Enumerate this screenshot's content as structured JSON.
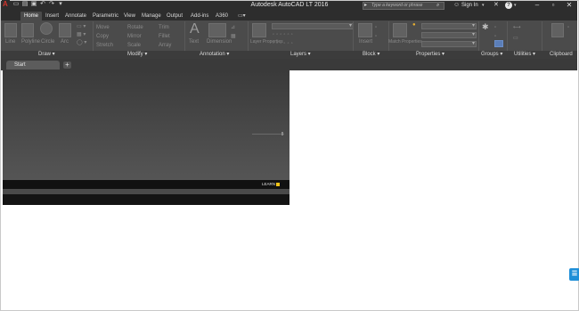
{
  "app": {
    "title": "Autodesk AutoCAD LT 2016",
    "logo_letter": "A"
  },
  "search": {
    "placeholder": "Type a keyword or phrase"
  },
  "user": {
    "signin_label": "Sign In"
  },
  "ribbon_tabs": [
    "Home",
    "Insert",
    "Annotate",
    "Parametric",
    "View",
    "Manage",
    "Output",
    "Add-ins",
    "A360"
  ],
  "active_tab": "Home",
  "panels": [
    "Draw",
    "Modify",
    "Annotation",
    "Layers",
    "Block",
    "Properties",
    "Groups",
    "Utilities",
    "Clipboard"
  ],
  "draw_tools": [
    "Line",
    "Polyline",
    "Circle",
    "Arc"
  ],
  "modify_tools": [
    "Move",
    "Rotate",
    "Trim",
    "Copy",
    "Mirror",
    "Fillet",
    "Stretch",
    "Scale",
    "Array"
  ],
  "annotation_tools": [
    "Text",
    "Dimension"
  ],
  "layer_tools": [
    "Layer Properties"
  ],
  "block_tools": [
    "Insert"
  ],
  "property_tools": [
    "Match Properties"
  ],
  "document_tab": "Start",
  "new_tab_symbol": "+",
  "start_page": {
    "learn_label": "LEARN"
  },
  "icons": {
    "menu": "application-menu-icon",
    "search": "search-icon",
    "help": "help-icon",
    "chat": "chat-icon"
  },
  "colors": {
    "titlebar": "#2d2d2d",
    "ribbon": "#4b4b4b",
    "accent_learn": "#f2c318",
    "chat": "#1f8fd8"
  }
}
